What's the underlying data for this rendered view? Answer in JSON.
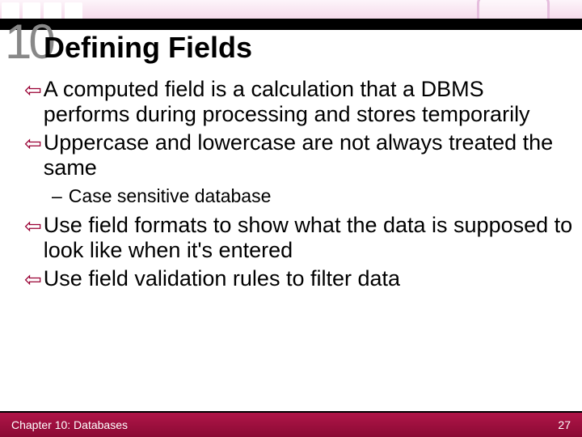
{
  "chapter_number": "10",
  "title": "Defining Fields",
  "bullets": [
    {
      "level": 1,
      "text": "A computed field is a calculation that a DBMS performs during processing and stores temporarily"
    },
    {
      "level": 1,
      "text": "Uppercase and lowercase are not always treated the same"
    },
    {
      "level": 2,
      "text": "Case sensitive database"
    },
    {
      "level": 1,
      "text": "Use field formats to show what the data is supposed to look like when it's entered"
    },
    {
      "level": 1,
      "text": "Use field validation rules to filter data"
    }
  ],
  "footer": {
    "left": "Chapter 10: Databases",
    "right": "27"
  },
  "colors": {
    "accent": "#9a0a3a",
    "bullet_arrow": "#990033"
  }
}
